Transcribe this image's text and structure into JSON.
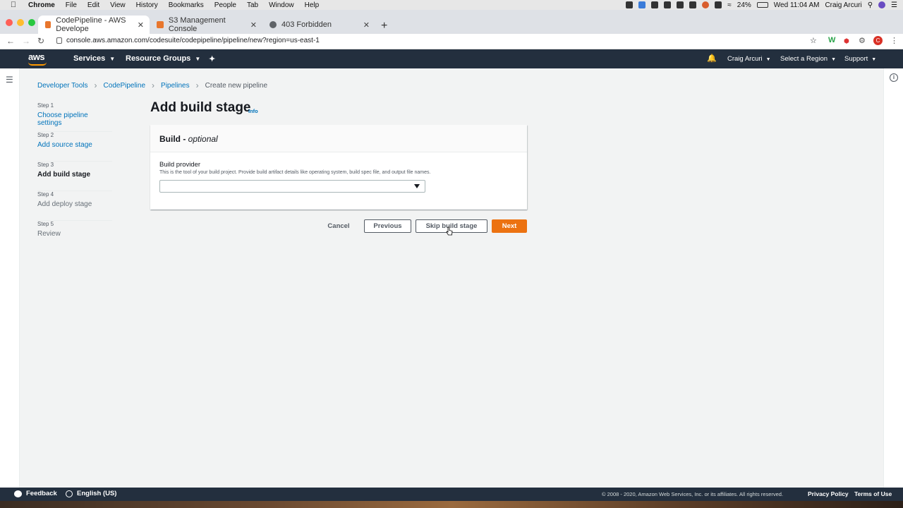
{
  "macos": {
    "app": "Chrome",
    "menus": [
      "File",
      "Edit",
      "View",
      "History",
      "Bookmarks",
      "People",
      "Tab",
      "Window",
      "Help"
    ],
    "battery": "24%",
    "clock": "Wed 11:04 AM",
    "user": "Craig Arcuri"
  },
  "browser": {
    "tabs": [
      {
        "title": "CodePipeline - AWS Develope",
        "active": true,
        "favicon_color": "#e8762d"
      },
      {
        "title": "S3 Management Console",
        "active": false,
        "favicon_color": "#e8762d"
      },
      {
        "title": "403 Forbidden",
        "active": false,
        "favicon_color": "#5f6368"
      }
    ],
    "url": "console.aws.amazon.com/codesuite/codepipeline/pipeline/new?region=us-east-1"
  },
  "aws_header": {
    "logo": "aws",
    "services": "Services",
    "resource_groups": "Resource Groups",
    "account": "Craig Arcuri",
    "region": "Select a Region",
    "support": "Support"
  },
  "breadcrumb": [
    "Developer Tools",
    "CodePipeline",
    "Pipelines",
    "Create new pipeline"
  ],
  "steps": [
    {
      "num": "Step 1",
      "name": "Choose pipeline settings",
      "state": "link"
    },
    {
      "num": "Step 2",
      "name": "Add source stage",
      "state": "link"
    },
    {
      "num": "Step 3",
      "name": "Add build stage",
      "state": "current"
    },
    {
      "num": "Step 4",
      "name": "Add deploy stage",
      "state": "disabled"
    },
    {
      "num": "Step 5",
      "name": "Review",
      "state": "disabled"
    }
  ],
  "main": {
    "title": "Add build stage",
    "info": "Info",
    "panel_title": "Build",
    "panel_title_suffix": "optional",
    "panel_title_dash": " - ",
    "field_label": "Build provider",
    "field_desc": "This is the tool of your build project. Provide build artifact details like operating system, build spec file, and output file names.",
    "field_value": ""
  },
  "buttons": {
    "cancel": "Cancel",
    "previous": "Previous",
    "skip": "Skip build stage",
    "next": "Next"
  },
  "footer": {
    "feedback": "Feedback",
    "language": "English (US)",
    "copyright": "© 2008 - 2020, Amazon Web Services, Inc. or its affiliates. All rights reserved.",
    "privacy": "Privacy Policy",
    "terms": "Terms of Use"
  },
  "colors": {
    "aws_nav": "#232f3e",
    "primary_button": "#ec7211",
    "link": "#0073bb"
  }
}
